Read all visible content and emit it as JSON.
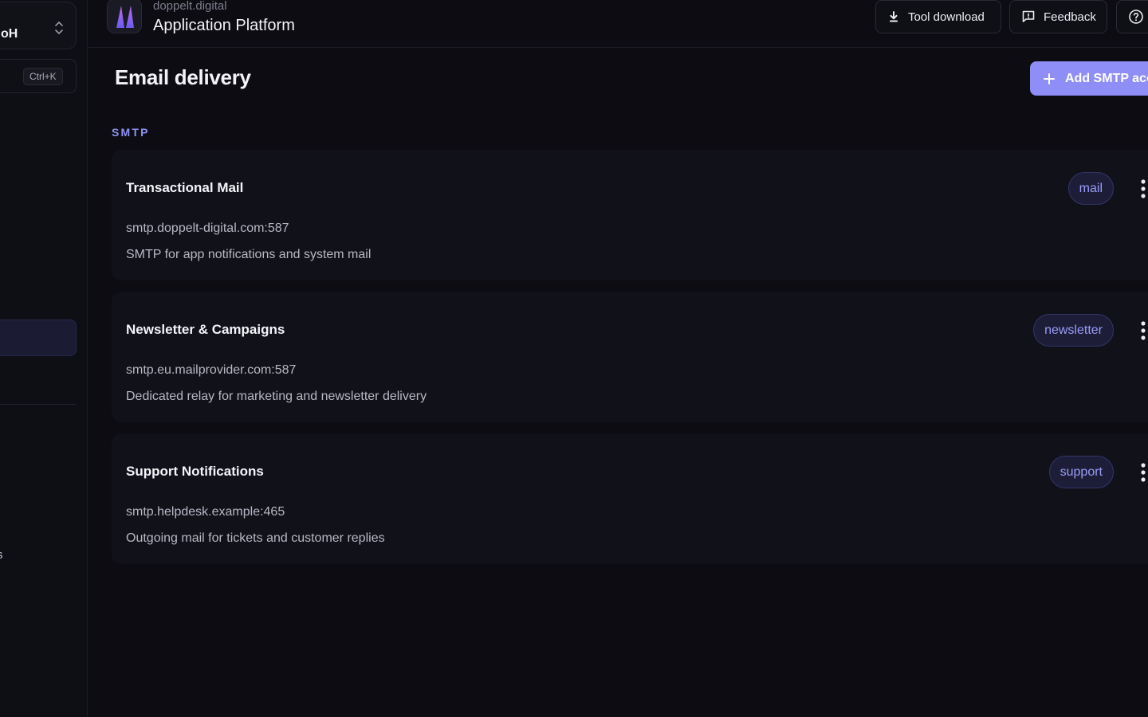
{
  "sidebar": {
    "org_name": "oH",
    "search_shortcut": "Ctrl+K",
    "clipped_item": "s"
  },
  "header": {
    "company": "doppelt.digital",
    "title": "Application Platform",
    "tool_download_label": "Tool download",
    "feedback_label": "Feedback"
  },
  "page": {
    "title": "Email delivery",
    "add_button_label": "Add SMTP acc",
    "section_label": "SMTP"
  },
  "accounts": [
    {
      "name": "Transactional Mail",
      "host": "smtp.doppelt-digital.com:587",
      "description": "SMTP for app notifications and system mail",
      "tag": "mail"
    },
    {
      "name": "Newsletter & Campaigns",
      "host": "smtp.eu.mailprovider.com:587",
      "description": "Dedicated relay for marketing and newsletter delivery",
      "tag": "newsletter"
    },
    {
      "name": "Support Notifications",
      "host": "smtp.helpdesk.example:465",
      "description": "Outgoing mail for tickets and customer replies",
      "tag": "support"
    }
  ],
  "colors": {
    "accent": "#8f8ef7",
    "tag_text": "#9a9cf8",
    "background": "#0c0c12",
    "card": "#11111a"
  },
  "icons": {
    "org_switcher": "chevron-up-down-icon",
    "tool_download": "download-icon",
    "feedback": "feedback-icon",
    "help": "help-circle-icon",
    "add": "plus-icon",
    "card_menu": "kebab-menu-icon",
    "logo": "doppelt-logo-icon"
  }
}
